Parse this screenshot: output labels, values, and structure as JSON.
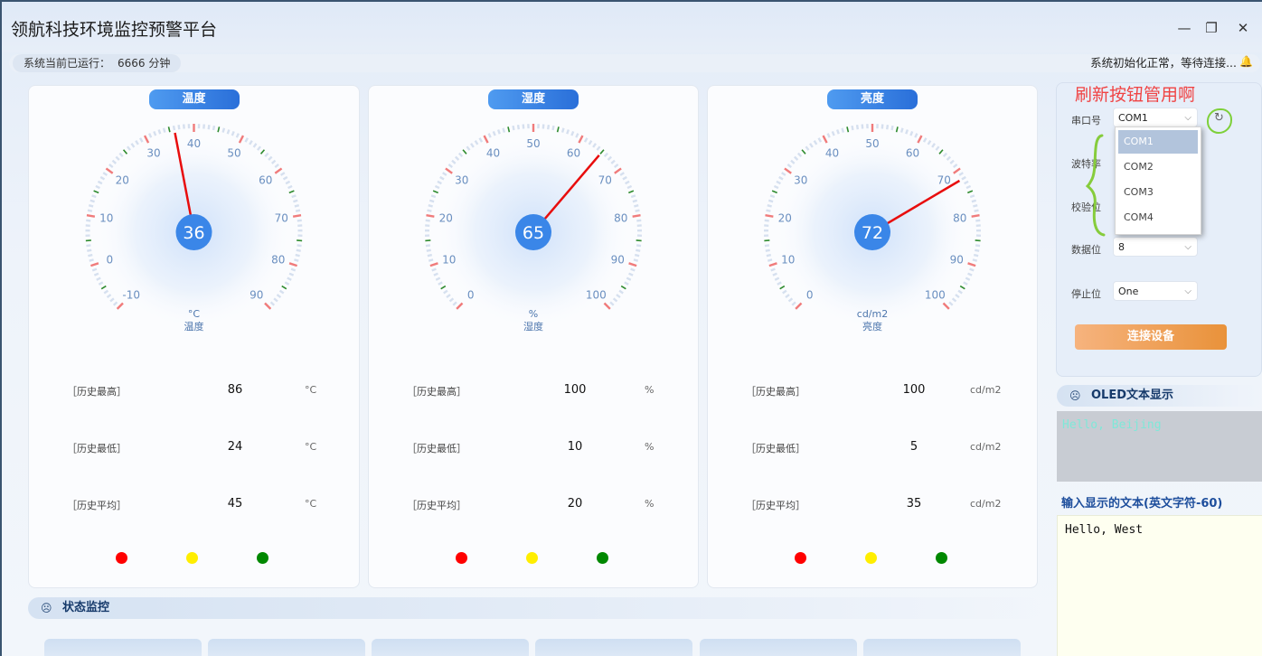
{
  "window": {
    "title": "领航科技环境监控预警平台",
    "minimize_glyph": "—",
    "restore_glyph": "❐",
    "close_glyph": "✕"
  },
  "statusbar": {
    "runtime_label": "系统当前已运行：",
    "runtime_value": "6666 分钟",
    "message": "系统初始化正常，等待连接...",
    "bell_glyph": "🔔"
  },
  "gauges": [
    {
      "title": "温度",
      "unit": "°C",
      "caption": "温度",
      "value": "36",
      "needle_value": 36,
      "min": -10,
      "max": 90,
      "ticks": [
        "-10",
        "0",
        "10",
        "20",
        "30",
        "40",
        "50",
        "60",
        "70",
        "80",
        "90"
      ],
      "stats": [
        {
          "label": "［历史最高］",
          "value": "86",
          "unit": "°C"
        },
        {
          "label": "［历史最低］",
          "value": "24",
          "unit": "°C"
        },
        {
          "label": "［历史平均］",
          "value": "45",
          "unit": "°C"
        }
      ]
    },
    {
      "title": "湿度",
      "unit": "%",
      "caption": "湿度",
      "value": "65",
      "needle_value": 65,
      "min": 0,
      "max": 100,
      "ticks": [
        "0",
        "10",
        "20",
        "30",
        "40",
        "50",
        "60",
        "70",
        "80",
        "90",
        "100"
      ],
      "stats": [
        {
          "label": "［历史最高］",
          "value": "100",
          "unit": "%"
        },
        {
          "label": "［历史最低］",
          "value": "10",
          "unit": "%"
        },
        {
          "label": "［历史平均］",
          "value": "20",
          "unit": "%"
        }
      ]
    },
    {
      "title": "亮度",
      "unit": "cd/m2",
      "caption": "亮度",
      "value": "72",
      "needle_value": 72,
      "min": 0,
      "max": 100,
      "ticks": [
        "0",
        "10",
        "20",
        "30",
        "40",
        "50",
        "60",
        "70",
        "80",
        "90",
        "100"
      ],
      "stats": [
        {
          "label": "［历史最高］",
          "value": "100",
          "unit": "cd/m2"
        },
        {
          "label": "［历史最低］",
          "value": "5",
          "unit": "cd/m2"
        },
        {
          "label": "［历史平均］",
          "value": "35",
          "unit": "cd/m2"
        }
      ]
    }
  ],
  "indicator_colors": [
    "#ff0000",
    "#ffee00",
    "#008800"
  ],
  "serial": {
    "annotation": "刷新按钮管用啊",
    "port_label": "串口号",
    "port_value": "COM1",
    "baud_label": "波特率",
    "parity_label": "校验位",
    "databits_label": "数据位",
    "databits_value": "8",
    "stopbits_label": "停止位",
    "stopbits_value": "One",
    "refresh_glyph": "↻",
    "chevron": "⌵",
    "dropdown_options": [
      "COM1",
      "COM2",
      "COM3",
      "COM4"
    ],
    "connect_label": "连接设备"
  },
  "oled": {
    "header_icon": "☹",
    "header": "OLED文本显示",
    "display_text": "Hello, Beijing",
    "input_label": "输入显示的文本(英文字符-60)",
    "input_text": "Hello, West"
  },
  "status_monitor": {
    "header_icon": "☹",
    "header": "状态监控"
  }
}
